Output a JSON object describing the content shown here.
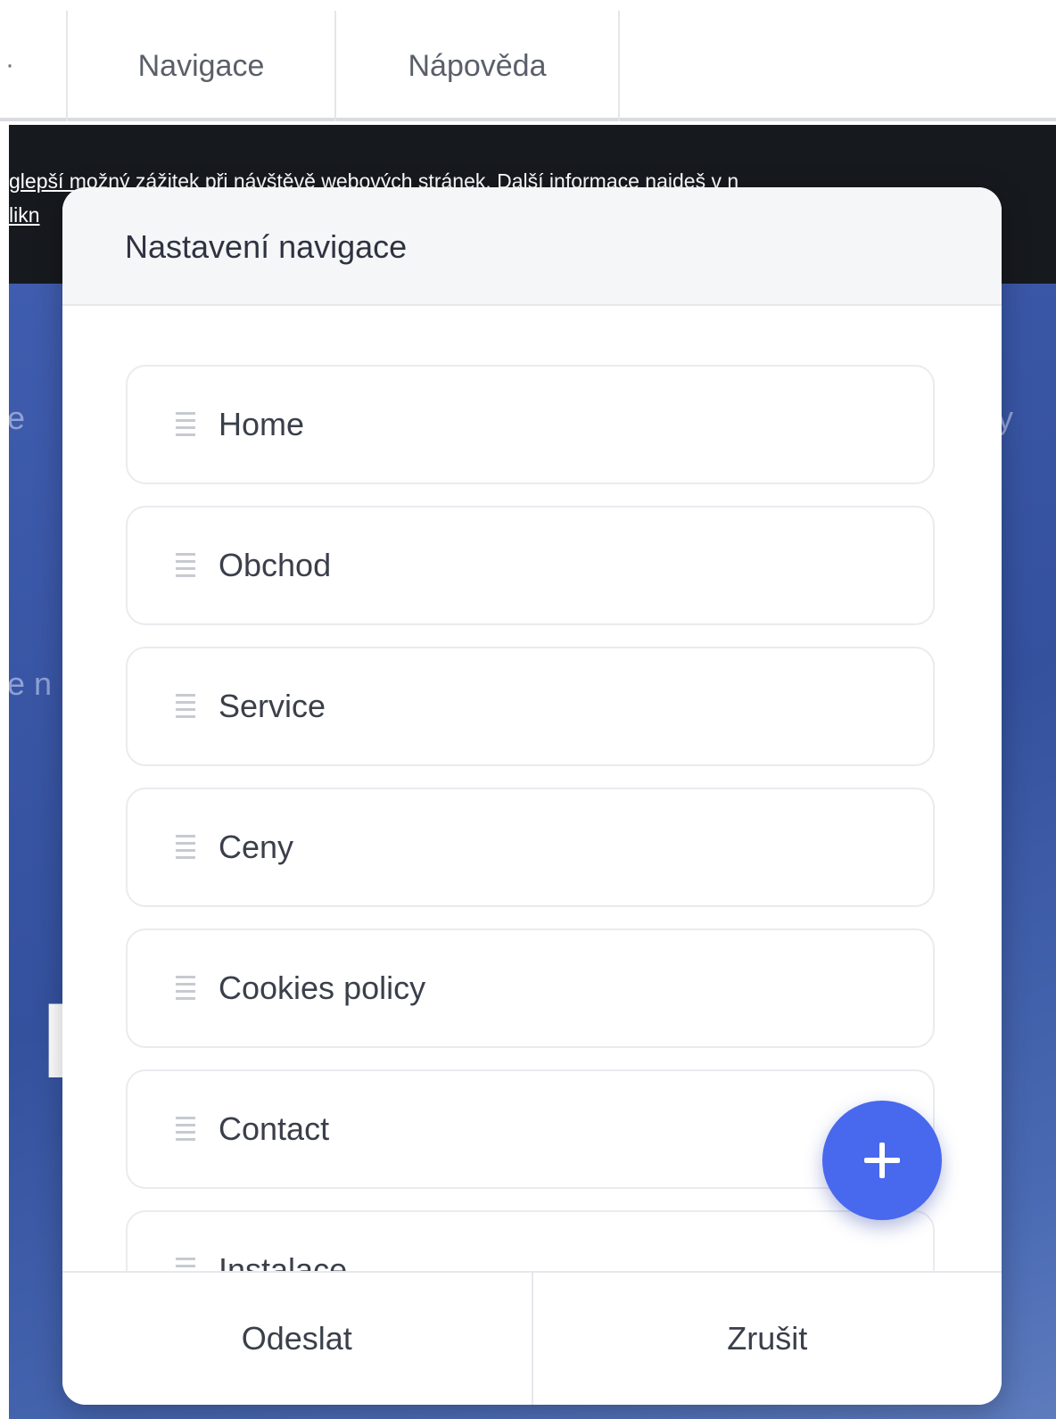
{
  "topbar": {
    "edge_tab_label": "·",
    "tabs": [
      {
        "label": "Navigace"
      },
      {
        "label": "Nápověda"
      }
    ]
  },
  "cookie_banner": {
    "line1": "glepší možný zážitek při návštěvě webových stránek. Další informace najdeš v n",
    "line2": "likn"
  },
  "hero": {
    "fragment_left_1": "e",
    "fragment_right_1": "cy",
    "fragment_left_2": "e n",
    "fragment_big": "I I"
  },
  "modal": {
    "title": "Nastavení navigace",
    "items": [
      {
        "label": "Home"
      },
      {
        "label": "Obchod"
      },
      {
        "label": "Service"
      },
      {
        "label": "Ceny"
      },
      {
        "label": "Cookies policy"
      },
      {
        "label": "Contact"
      },
      {
        "label": "Instalace"
      }
    ],
    "add_button_icon": "plus-icon",
    "submit_label": "Odeslat",
    "cancel_label": "Zrušit"
  },
  "colors": {
    "accent": "#4868ee",
    "hero_blue": "#34519e",
    "cookie_bg": "#16191e"
  }
}
